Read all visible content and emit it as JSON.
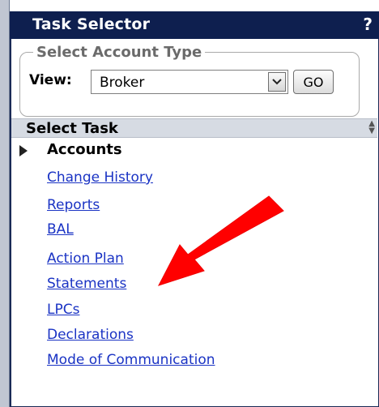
{
  "window": {
    "title": "Task Selector",
    "help_glyph": "?"
  },
  "account_type": {
    "legend": "Select Account Type",
    "view_label": "View:",
    "selected_view": "Broker",
    "go_label": "GO"
  },
  "task_section": {
    "header": "Select Task",
    "group_label": "Accounts",
    "links": [
      "Change History",
      "Reports",
      "BAL",
      "Action Plan",
      "Statements",
      "LPCs",
      "Declarations",
      "Mode of Communication"
    ]
  },
  "annotation": {
    "arrow_color": "#ff0000",
    "points_to": "Statements"
  }
}
